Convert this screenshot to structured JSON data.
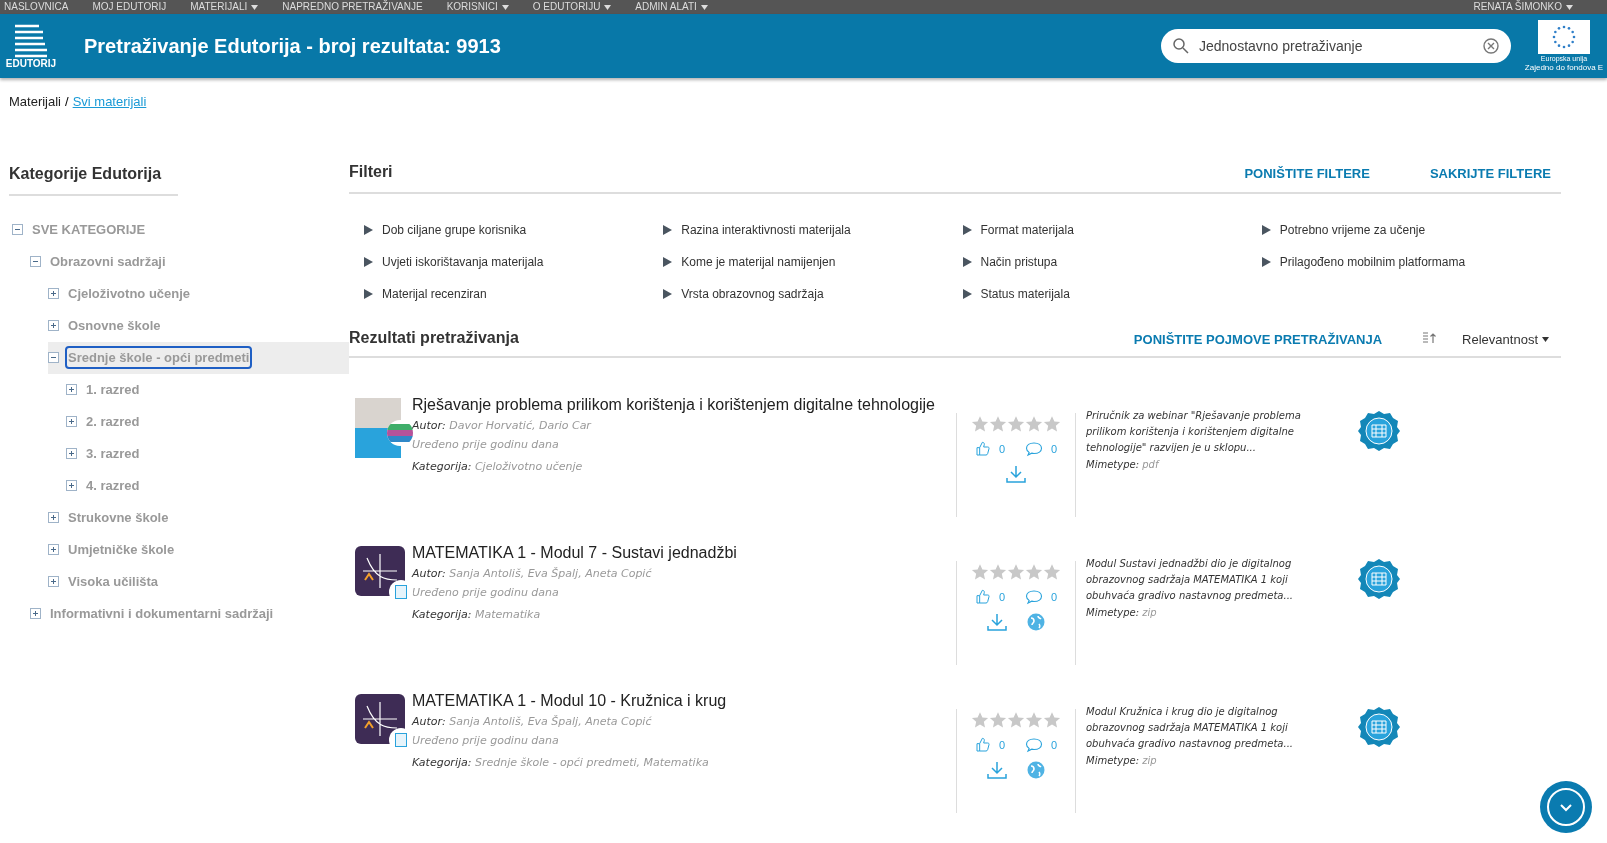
{
  "top_nav": {
    "items": [
      {
        "label": "NASLOVNICA",
        "has_menu": false
      },
      {
        "label": "MOJ EDUTORIJ",
        "has_menu": false
      },
      {
        "label": "MATERIJALI",
        "has_menu": true
      },
      {
        "label": "NAPREDNO PRETRAŽIVANJE",
        "has_menu": false
      },
      {
        "label": "KORISNICI",
        "has_menu": true
      },
      {
        "label": "O EDUTORIJU",
        "has_menu": true
      },
      {
        "label": "ADMIN ALATI",
        "has_menu": true
      }
    ],
    "user": {
      "label": "RENATA ŠIMONKO",
      "has_menu": true
    }
  },
  "header": {
    "logo_text": "EDUTORIJ",
    "title": "Pretraživanje Edutorija - broj rezultata: 9913",
    "search": {
      "value": "Jednostavno pretraživanje"
    },
    "eu": {
      "line_1": "Europska unija",
      "line_2": "Zajedno do fondova E"
    }
  },
  "breadcrumb": {
    "items": [
      "Materijali"
    ],
    "separator": "/",
    "current": "Svi materijali"
  },
  "sidebar": {
    "title": "Kategorije Edutorija",
    "tree": [
      {
        "label": "SVE KATEGORIJE",
        "expanded": true,
        "selected": false,
        "children": [
          {
            "label": "Obrazovni sadržaji",
            "expanded": true,
            "selected": false,
            "children": [
              {
                "label": "Cjeloživotno učenje",
                "expanded": false,
                "selected": false
              },
              {
                "label": "Osnovne škole",
                "expanded": false,
                "selected": false
              },
              {
                "label": "Srednje škole - opći predmeti",
                "expanded": true,
                "selected": true,
                "children": [
                  {
                    "label": "1. razred",
                    "expanded": false,
                    "selected": false
                  },
                  {
                    "label": "2. razred",
                    "expanded": false,
                    "selected": false
                  },
                  {
                    "label": "3. razred",
                    "expanded": false,
                    "selected": false
                  },
                  {
                    "label": "4. razred",
                    "expanded": false,
                    "selected": false
                  }
                ]
              },
              {
                "label": "Strukovne škole",
                "expanded": false,
                "selected": false
              },
              {
                "label": "Umjetničke škole",
                "expanded": false,
                "selected": false
              },
              {
                "label": "Visoka učilišta",
                "expanded": false,
                "selected": false
              }
            ]
          },
          {
            "label": "Informativni i dokumentarni sadržaji",
            "expanded": false,
            "selected": false
          }
        ]
      }
    ]
  },
  "filters": {
    "title": "Filteri",
    "actions": [
      "PONIŠTITE FILTERE",
      "SAKRIJTE FILTERE"
    ],
    "columns": [
      [
        "Dob ciljane grupe korisnika",
        "Uvjeti iskorištavanja materijala",
        "Materijal recenziran"
      ],
      [
        "Razina interaktivnosti materijala",
        "Kome je materijal namijenjen",
        "Vrsta obrazovnog sadržaja"
      ],
      [
        "Format materijala",
        "Način pristupa",
        "Status materijala"
      ],
      [
        "Potrebno vrijeme za učenje",
        "Prilagođeno mobilnim platformama"
      ]
    ]
  },
  "results": {
    "title": "Rezultati pretraživanja",
    "reset": "PONIŠTITE POJMOVE PRETRAŽIVANJA",
    "sort": "Relevantnost",
    "items": [
      {
        "kind": "photo",
        "title": "Rješavanje problema prilikom korištenja i korištenjem digitalne tehnologije",
        "author_label": "Autor:",
        "author": "Davor Horvatić, Dario Car",
        "edited": "Uređeno prije godinu dana",
        "category_label": "Kategorija:",
        "category": "Cjeloživotno učenje",
        "stars": 0,
        "likes": "0",
        "comments": "0",
        "has_web": false,
        "description": "Priručnik za webinar \"Rješavanje problema prilikom korištenja i korištenjem digitalne tehnologije\" razvijen je u sklopu...",
        "mimetype_label": "Mimetype:",
        "mimetype": "pdf"
      },
      {
        "kind": "math",
        "title": "MATEMATIKA 1 - Modul 7 - Sustavi jednadžbi",
        "author_label": "Autor:",
        "author": "Sanja Antoliš, Eva Špalj, Aneta Copić",
        "edited": "Uređeno prije godinu dana",
        "category_label": "Kategorija:",
        "category": "Matematika",
        "stars": 0,
        "likes": "0",
        "comments": "0",
        "has_web": true,
        "description": "Modul Sustavi jednadžbi dio je digitalnog obrazovnog sadržaja MATEMATIKA 1 koji obuhvaća gradivo nastavnog predmeta...",
        "mimetype_label": "Mimetype:",
        "mimetype": "zip"
      },
      {
        "kind": "math",
        "title": "MATEMATIKA 1 - Modul 10 - Kružnica i krug",
        "author_label": "Autor:",
        "author": "Sanja Antoliš, Eva Špalj, Aneta Copić",
        "edited": "Uređeno prije godinu dana",
        "category_label": "Kategorija:",
        "category": "Srednje škole - opći predmeti, Matematika",
        "stars": 0,
        "likes": "0",
        "comments": "0",
        "has_web": true,
        "description": "Modul Kružnica i krug dio je digitalnog obrazovnog sadržaja MATEMATIKA 1 koji obuhvaća gradivo nastavnog predmeta...",
        "mimetype_label": "Mimetype:",
        "mimetype": "zip"
      }
    ]
  }
}
